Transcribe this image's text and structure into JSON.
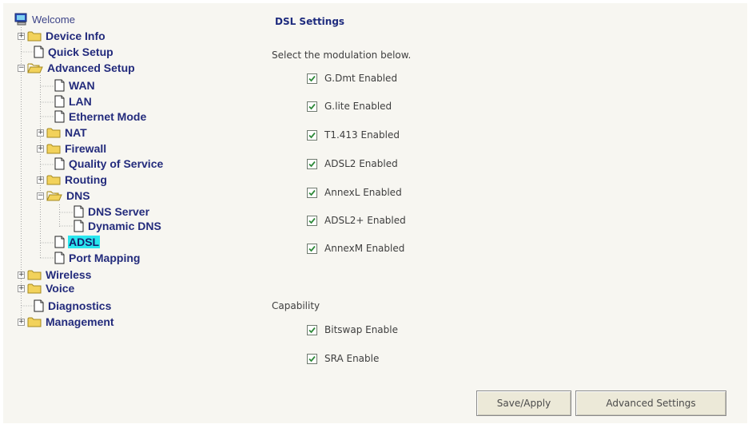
{
  "tree": {
    "welcome": "Welcome",
    "device_info": "Device Info",
    "quick_setup": "Quick Setup",
    "advanced_setup": "Advanced Setup",
    "wan": "WAN",
    "lan": "LAN",
    "ethernet_mode": "Ethernet Mode",
    "nat": "NAT",
    "firewall": "Firewall",
    "qos": "Quality of Service",
    "routing": "Routing",
    "dns": "DNS",
    "dns_server": "DNS Server",
    "dynamic_dns": "Dynamic DNS",
    "adsl": "ADSL",
    "port_mapping": "Port Mapping",
    "wireless": "Wireless",
    "voice": "Voice",
    "diagnostics": "Diagnostics",
    "management": "Management"
  },
  "content": {
    "title": "DSL Settings",
    "modulation_prompt": "Select the modulation below.",
    "modulations": [
      {
        "label": "G.Dmt Enabled",
        "checked": true
      },
      {
        "label": "G.lite Enabled",
        "checked": true
      },
      {
        "label": "T1.413 Enabled",
        "checked": true
      },
      {
        "label": "ADSL2 Enabled",
        "checked": true
      },
      {
        "label": "AnnexL Enabled",
        "checked": true
      },
      {
        "label": "ADSL2+ Enabled",
        "checked": true
      },
      {
        "label": "AnnexM Enabled",
        "checked": true
      }
    ],
    "capability_heading": "Capability",
    "capabilities": [
      {
        "label": "Bitswap Enable",
        "checked": true
      },
      {
        "label": "SRA Enable",
        "checked": true
      }
    ],
    "save_apply_label": "Save/Apply",
    "advanced_settings_label": "Advanced Settings"
  },
  "colors": {
    "tree_text": "#232b7c",
    "selected_highlight": "#29e6ee",
    "folder": "#f2d25b",
    "title_text": "#1e2b7e",
    "checkmark": "#2f8a3a"
  },
  "icons": {
    "welcome": "computer-icon",
    "folder": "folder-icon",
    "page": "page-icon",
    "expand": "plus-box-icon",
    "collapse": "minus-box-icon"
  }
}
